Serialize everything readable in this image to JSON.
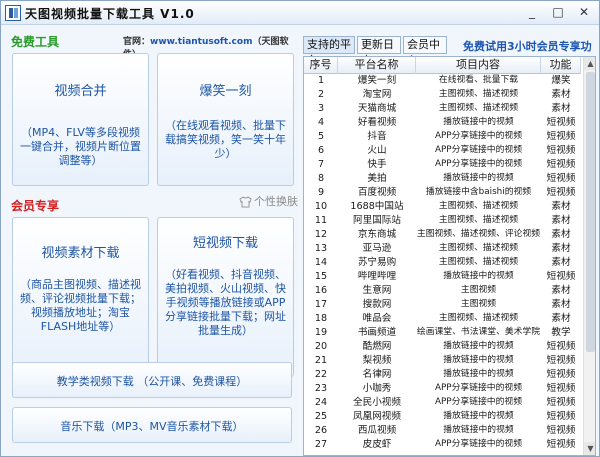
{
  "window": {
    "title": "天图视频批量下载工具 V1.0",
    "minimize": "_",
    "maximize": "□",
    "close": "✕"
  },
  "free": {
    "label": "免费工具",
    "site_prefix": "官网：",
    "site_url": "www.tiantusoft.com",
    "site_suffix": "（天图软件）",
    "tiles": [
      {
        "title": "视频合并",
        "desc": "（MP4、FLV等多段视频一键合并，视频片断位置调整等）"
      },
      {
        "title": "爆笑一刻",
        "desc": "（在线观看视频、批量下载搞笑视频，笑一笑十年少）"
      }
    ]
  },
  "member": {
    "label": "会员专享",
    "skin_button": "个性换肤",
    "tiles": [
      {
        "title": "视频素材下载",
        "desc": "（商品主图视频、描述视频、评论视频批量下载；视频播放地址；淘宝FLASH地址等）"
      },
      {
        "title": "短视频下载",
        "desc": "（好看视频、抖音视频、美拍视频、火山视频、快手视频等播放链接或APP分享链接批量下载；网址批量生成）"
      },
      {
        "title": "教学类视频下载 （公开课、免费课程）"
      },
      {
        "title": "音乐下载（MP3、MV音乐素材下载）"
      }
    ]
  },
  "tabs": [
    "支持的平台",
    "更新日志",
    "会员中心"
  ],
  "trial_link": "免费试用3小时会员专享功能!",
  "table": {
    "headers": [
      "序号",
      "平台名称",
      "项目内容",
      "功能"
    ],
    "rows": [
      [
        "1",
        "爆笑一刻",
        "在线视看、批量下载",
        "爆笑"
      ],
      [
        "2",
        "淘宝网",
        "主图视频、描述视频",
        "素材"
      ],
      [
        "3",
        "天猫商城",
        "主图视频、描述视频",
        "素材"
      ],
      [
        "4",
        "好看视频",
        "播放链接中的视频",
        "短视频"
      ],
      [
        "5",
        "抖音",
        "APP分享链接中的视频",
        "短视频"
      ],
      [
        "6",
        "火山",
        "APP分享链接中的视频",
        "短视频"
      ],
      [
        "7",
        "快手",
        "APP分享链接中的视频",
        "短视频"
      ],
      [
        "8",
        "美拍",
        "播放链接中的视频",
        "短视频"
      ],
      [
        "9",
        "百度视频",
        "播放链接中含baishi的视频",
        "短视频"
      ],
      [
        "10",
        "1688中国站",
        "主图视频、描述视频",
        "素材"
      ],
      [
        "11",
        "阿里国际站",
        "主图视频、描述视频",
        "素材"
      ],
      [
        "12",
        "京东商城",
        "主图视频、描述视频、评论视频",
        "素材"
      ],
      [
        "13",
        "亚马逊",
        "主图视频、描述视频",
        "素材"
      ],
      [
        "14",
        "苏宁易购",
        "主图视频、描述视频",
        "素材"
      ],
      [
        "15",
        "哔哩哔哩",
        "播放链接中的视频",
        "短视频"
      ],
      [
        "16",
        "生意网",
        "主图视频",
        "素材"
      ],
      [
        "17",
        "搜款网",
        "主图视频",
        "素材"
      ],
      [
        "18",
        "唯品会",
        "主图视频、描述视频",
        "素材"
      ],
      [
        "19",
        "书画频道",
        "绘画课堂、书法课堂、美术学院",
        "教学"
      ],
      [
        "20",
        "酷燃网",
        "播放链接中的视频",
        "短视频"
      ],
      [
        "21",
        "梨视频",
        "播放链接中的视频",
        "短视频"
      ],
      [
        "22",
        "名律网",
        "播放链接中的视频",
        "短视频"
      ],
      [
        "23",
        "小咖秀",
        "APP分享链接中的视频",
        "短视频"
      ],
      [
        "24",
        "全民小视频",
        "APP分享链接中的视频",
        "短视频"
      ],
      [
        "25",
        "凤凰网视频",
        "播放链接中的视频",
        "短视频"
      ],
      [
        "26",
        "西瓜视频",
        "播放链接中的视频",
        "短视频"
      ],
      [
        "27",
        "皮皮虾",
        "APP分享链接中的视频",
        "短视频"
      ]
    ]
  }
}
